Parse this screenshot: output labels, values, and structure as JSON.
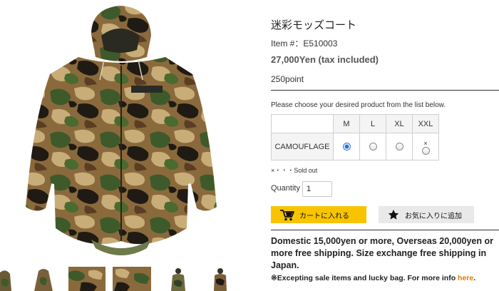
{
  "product": {
    "title": "迷彩モッズコート",
    "item_number": "Item #：E510003",
    "price": "27,000Yen (tax included)",
    "point": "250point"
  },
  "variants": {
    "instruction": "Please choose your desired product from the list below.",
    "sizes": [
      "M",
      "L",
      "XL",
      "XXL"
    ],
    "color": "CAMOUFLAGE",
    "selected_size": "M",
    "sold_out_mark": "×",
    "sold_out_legend": "×・・・Sold out"
  },
  "quantity": {
    "label": "Quantity",
    "value": "1"
  },
  "buttons": {
    "cart": "カートに入れる",
    "favorite": "お気に入りに追加"
  },
  "shipping": {
    "text": "Domestic 15,000yen or more, Overseas 20,000yen or more free shipping. Size exchange free shipping in Japan.",
    "note_prefix": "※Excepting sale items and lucky bag. For more info ",
    "note_link": "here",
    "note_suffix": "."
  },
  "colors": {
    "cart_button": "#f8c400",
    "favorite_button": "#e9e9e9",
    "link": "#e07b00",
    "radio_selected": "#2b6fd6"
  },
  "icons": {
    "cart": "cart-icon",
    "favorite": "star-icon"
  }
}
